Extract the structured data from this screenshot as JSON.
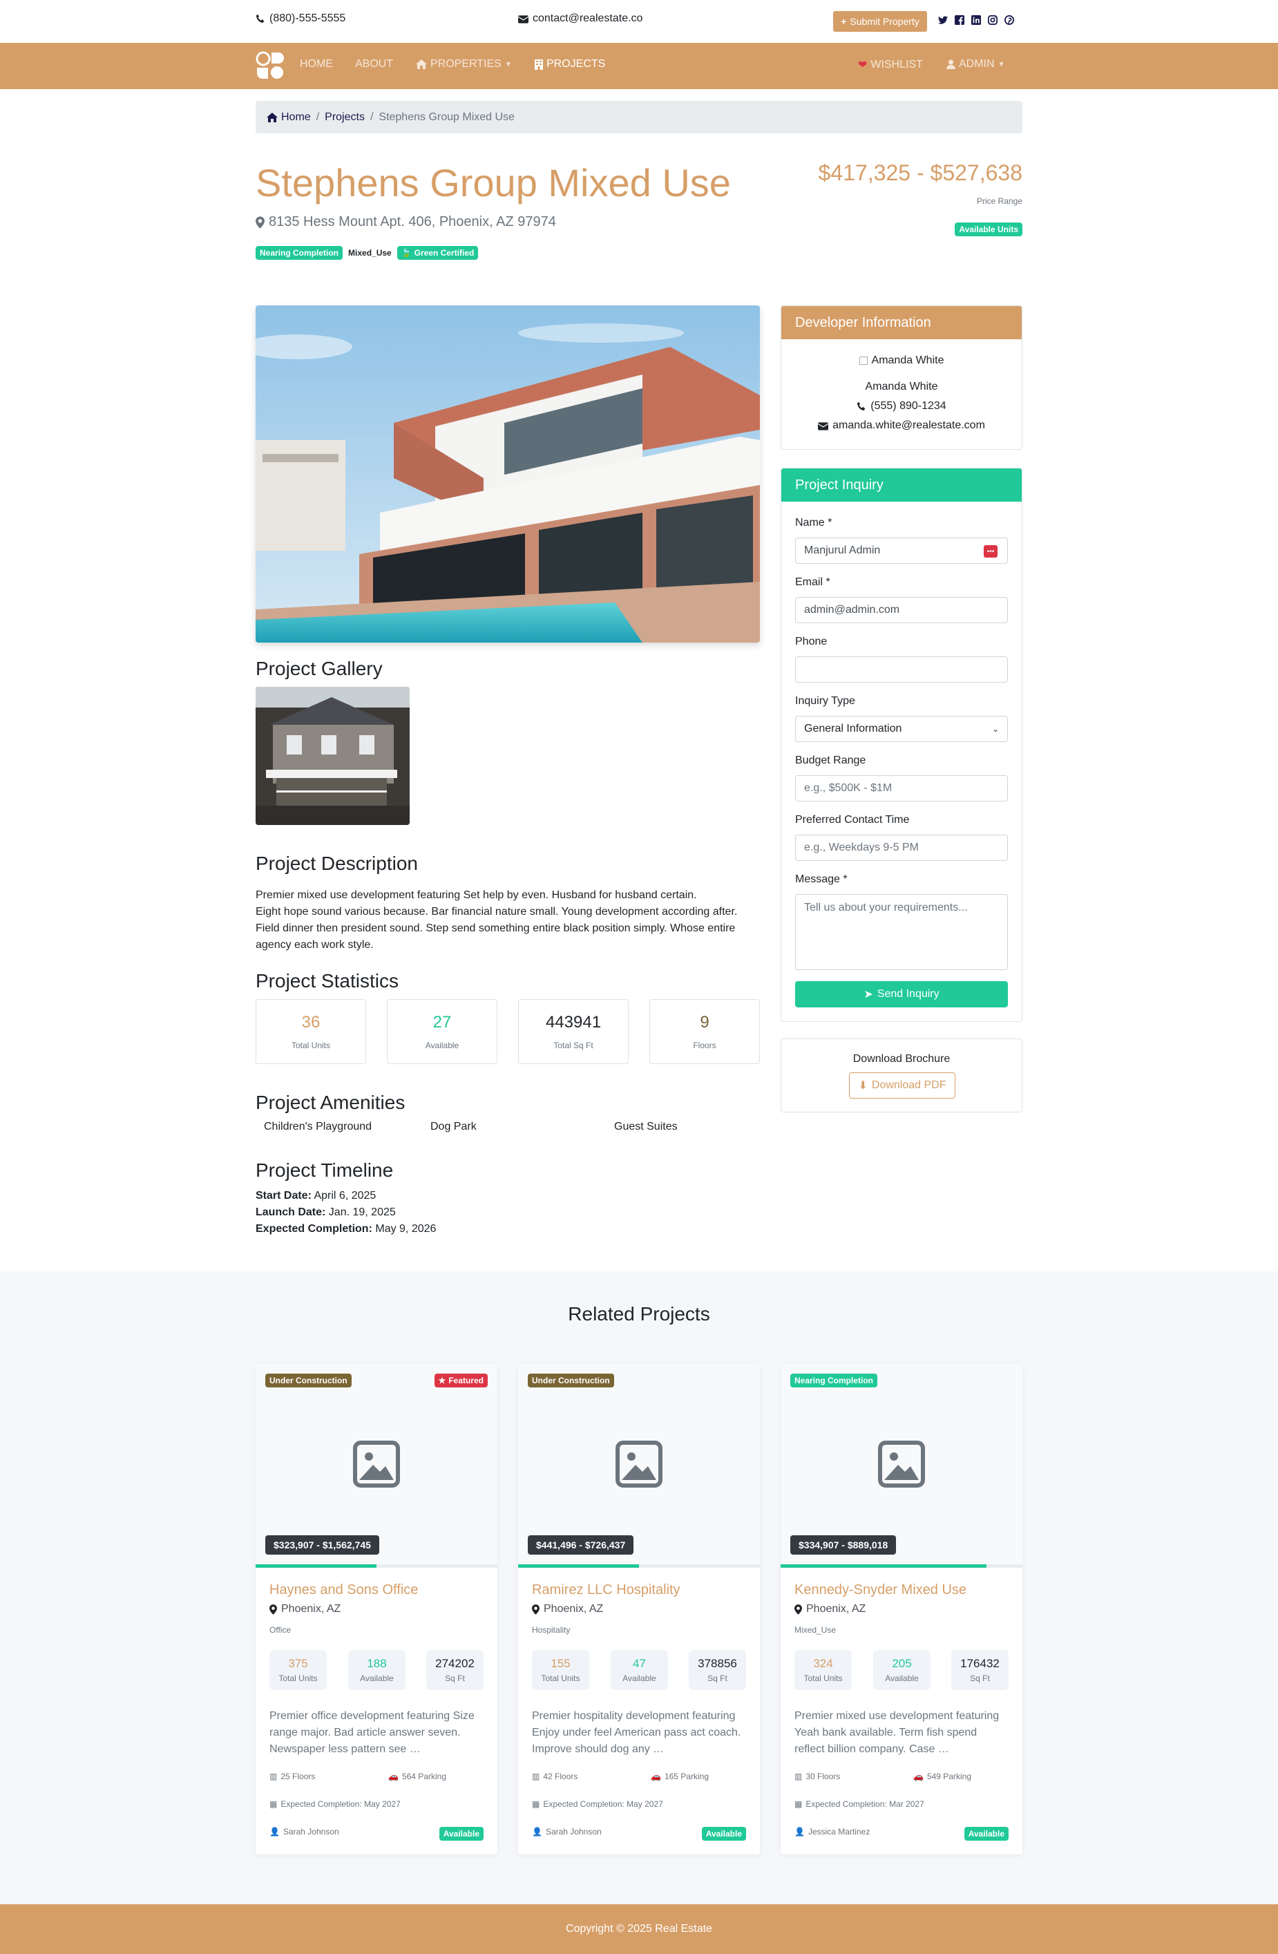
{
  "topbar": {
    "phone": "(880)-555-5555",
    "email": "contact@realestate.co",
    "submit_label": "Submit Property",
    "socials": [
      "twitter-icon",
      "facebook-icon",
      "linkedin-icon",
      "instagram-icon",
      "pinterest-icon"
    ]
  },
  "nav": {
    "items": [
      "HOME",
      "ABOUT",
      "PROPERTIES",
      "PROJECTS"
    ],
    "wishlist": "WISHLIST",
    "admin": "ADMIN"
  },
  "breadcrumb": {
    "home": "Home",
    "projects": "Projects",
    "current": "Stephens Group Mixed Use"
  },
  "project": {
    "title": "Stephens Group Mixed Use",
    "address": "8135 Hess Mount Apt. 406, Phoenix, AZ 97974",
    "badges": [
      "Nearing Completion",
      "Mixed_Use",
      "Green Certified"
    ],
    "price_range": "$417,325 - $527,638",
    "price_label": "Price Range",
    "availability": "Available Units"
  },
  "gallery": {
    "heading": "Project Gallery"
  },
  "description": {
    "heading": "Project Description",
    "lines": [
      "Premier mixed use development featuring Set help by even. Husband for husband certain.",
      "Eight hope sound various because. Bar financial nature small. Young development according after. Field dinner then president sound. Step send something entire black position simply. Whose entire agency each work style."
    ]
  },
  "statistics": {
    "heading": "Project Statistics",
    "items": [
      {
        "value": "36",
        "label": "Total Units",
        "color": "#d69e67"
      },
      {
        "value": "27",
        "label": "Available",
        "color": "#20c997"
      },
      {
        "value": "443941",
        "label": "Total Sq Ft",
        "color": "#212529"
      },
      {
        "value": "9",
        "label": "Floors",
        "color": "#7a6535"
      }
    ]
  },
  "amenities": {
    "heading": "Project Amenities",
    "items": [
      "Children's Playground",
      "Dog Park",
      "Guest Suites"
    ]
  },
  "timeline": {
    "heading": "Project Timeline",
    "start_label": "Start Date:",
    "start": "April 6, 2025",
    "launch_label": "Launch Date:",
    "launch": "Jan. 19, 2025",
    "completion_label": "Expected Completion:",
    "completion": "May 9, 2026"
  },
  "developer": {
    "heading": "Developer Information",
    "avatar_alt": "Amanda White",
    "name": "Amanda White",
    "phone": "(555) 890-1234",
    "email": "amanda.white@realestate.com"
  },
  "inquiry": {
    "heading": "Project Inquiry",
    "name_label": "Name *",
    "name_value": "Manjurul Admin",
    "email_label": "Email *",
    "email_value": "admin@admin.com",
    "phone_label": "Phone",
    "type_label": "Inquiry Type",
    "type_value": "General Information",
    "budget_label": "Budget Range",
    "budget_placeholder": "e.g., $500K - $1M",
    "contact_label": "Preferred Contact Time",
    "contact_placeholder": "e.g., Weekdays 9-5 PM",
    "message_label": "Message *",
    "message_placeholder": "Tell us about your requirements...",
    "send_label": "Send Inquiry"
  },
  "brochure": {
    "heading": "Download Brochure",
    "button": "Download PDF"
  },
  "related": {
    "heading": "Related Projects",
    "cards": [
      {
        "status": "Under Construction",
        "featured": "Featured",
        "price": "$323,907 - $1,562,745",
        "progress": 0.5,
        "name": "Haynes and Sons Office",
        "location": "Phoenix, AZ",
        "type": "Office",
        "units": "375",
        "available": "188",
        "sqft": "274202",
        "units_label": "Total Units",
        "available_label": "Available",
        "sqft_label": "Sq Ft",
        "description": "Premier office development featuring Size range major. Bad article answer seven. Newspaper less pattern see …",
        "floors": "25 Floors",
        "parking": "564 Parking",
        "completion": "Expected Completion: May 2027",
        "agent": "Sarah Johnson",
        "availability": "Available"
      },
      {
        "status": "Under Construction",
        "featured": "",
        "price": "$441,496 - $726,437",
        "progress": 0.5,
        "name": "Ramirez LLC Hospitality",
        "location": "Phoenix, AZ",
        "type": "Hospitality",
        "units": "155",
        "available": "47",
        "sqft": "378856",
        "units_label": "Total Units",
        "available_label": "Available",
        "sqft_label": "Sq Ft",
        "description": "Premier hospitality development featuring Enjoy under feel American pass act coach. Improve should dog any …",
        "floors": "42 Floors",
        "parking": "165 Parking",
        "completion": "Expected Completion: May 2027",
        "agent": "Sarah Johnson",
        "availability": "Available"
      },
      {
        "status": "Nearing Completion",
        "featured": "",
        "price": "$334,907 - $889,018",
        "progress": 0.85,
        "name": "Kennedy-Snyder Mixed Use",
        "location": "Phoenix, AZ",
        "type": "Mixed_Use",
        "units": "324",
        "available": "205",
        "sqft": "176432",
        "units_label": "Total Units",
        "available_label": "Available",
        "sqft_label": "Sq Ft",
        "description": "Premier mixed use development featuring Yeah bank available. Term fish spend reflect billion company. Case …",
        "floors": "30 Floors",
        "parking": "549 Parking",
        "completion": "Expected Completion: Mar 2027",
        "agent": "Jessica Martinez",
        "availability": "Available"
      }
    ]
  },
  "footer": {
    "copyright": "Copyright © 2025 Real Estate"
  }
}
